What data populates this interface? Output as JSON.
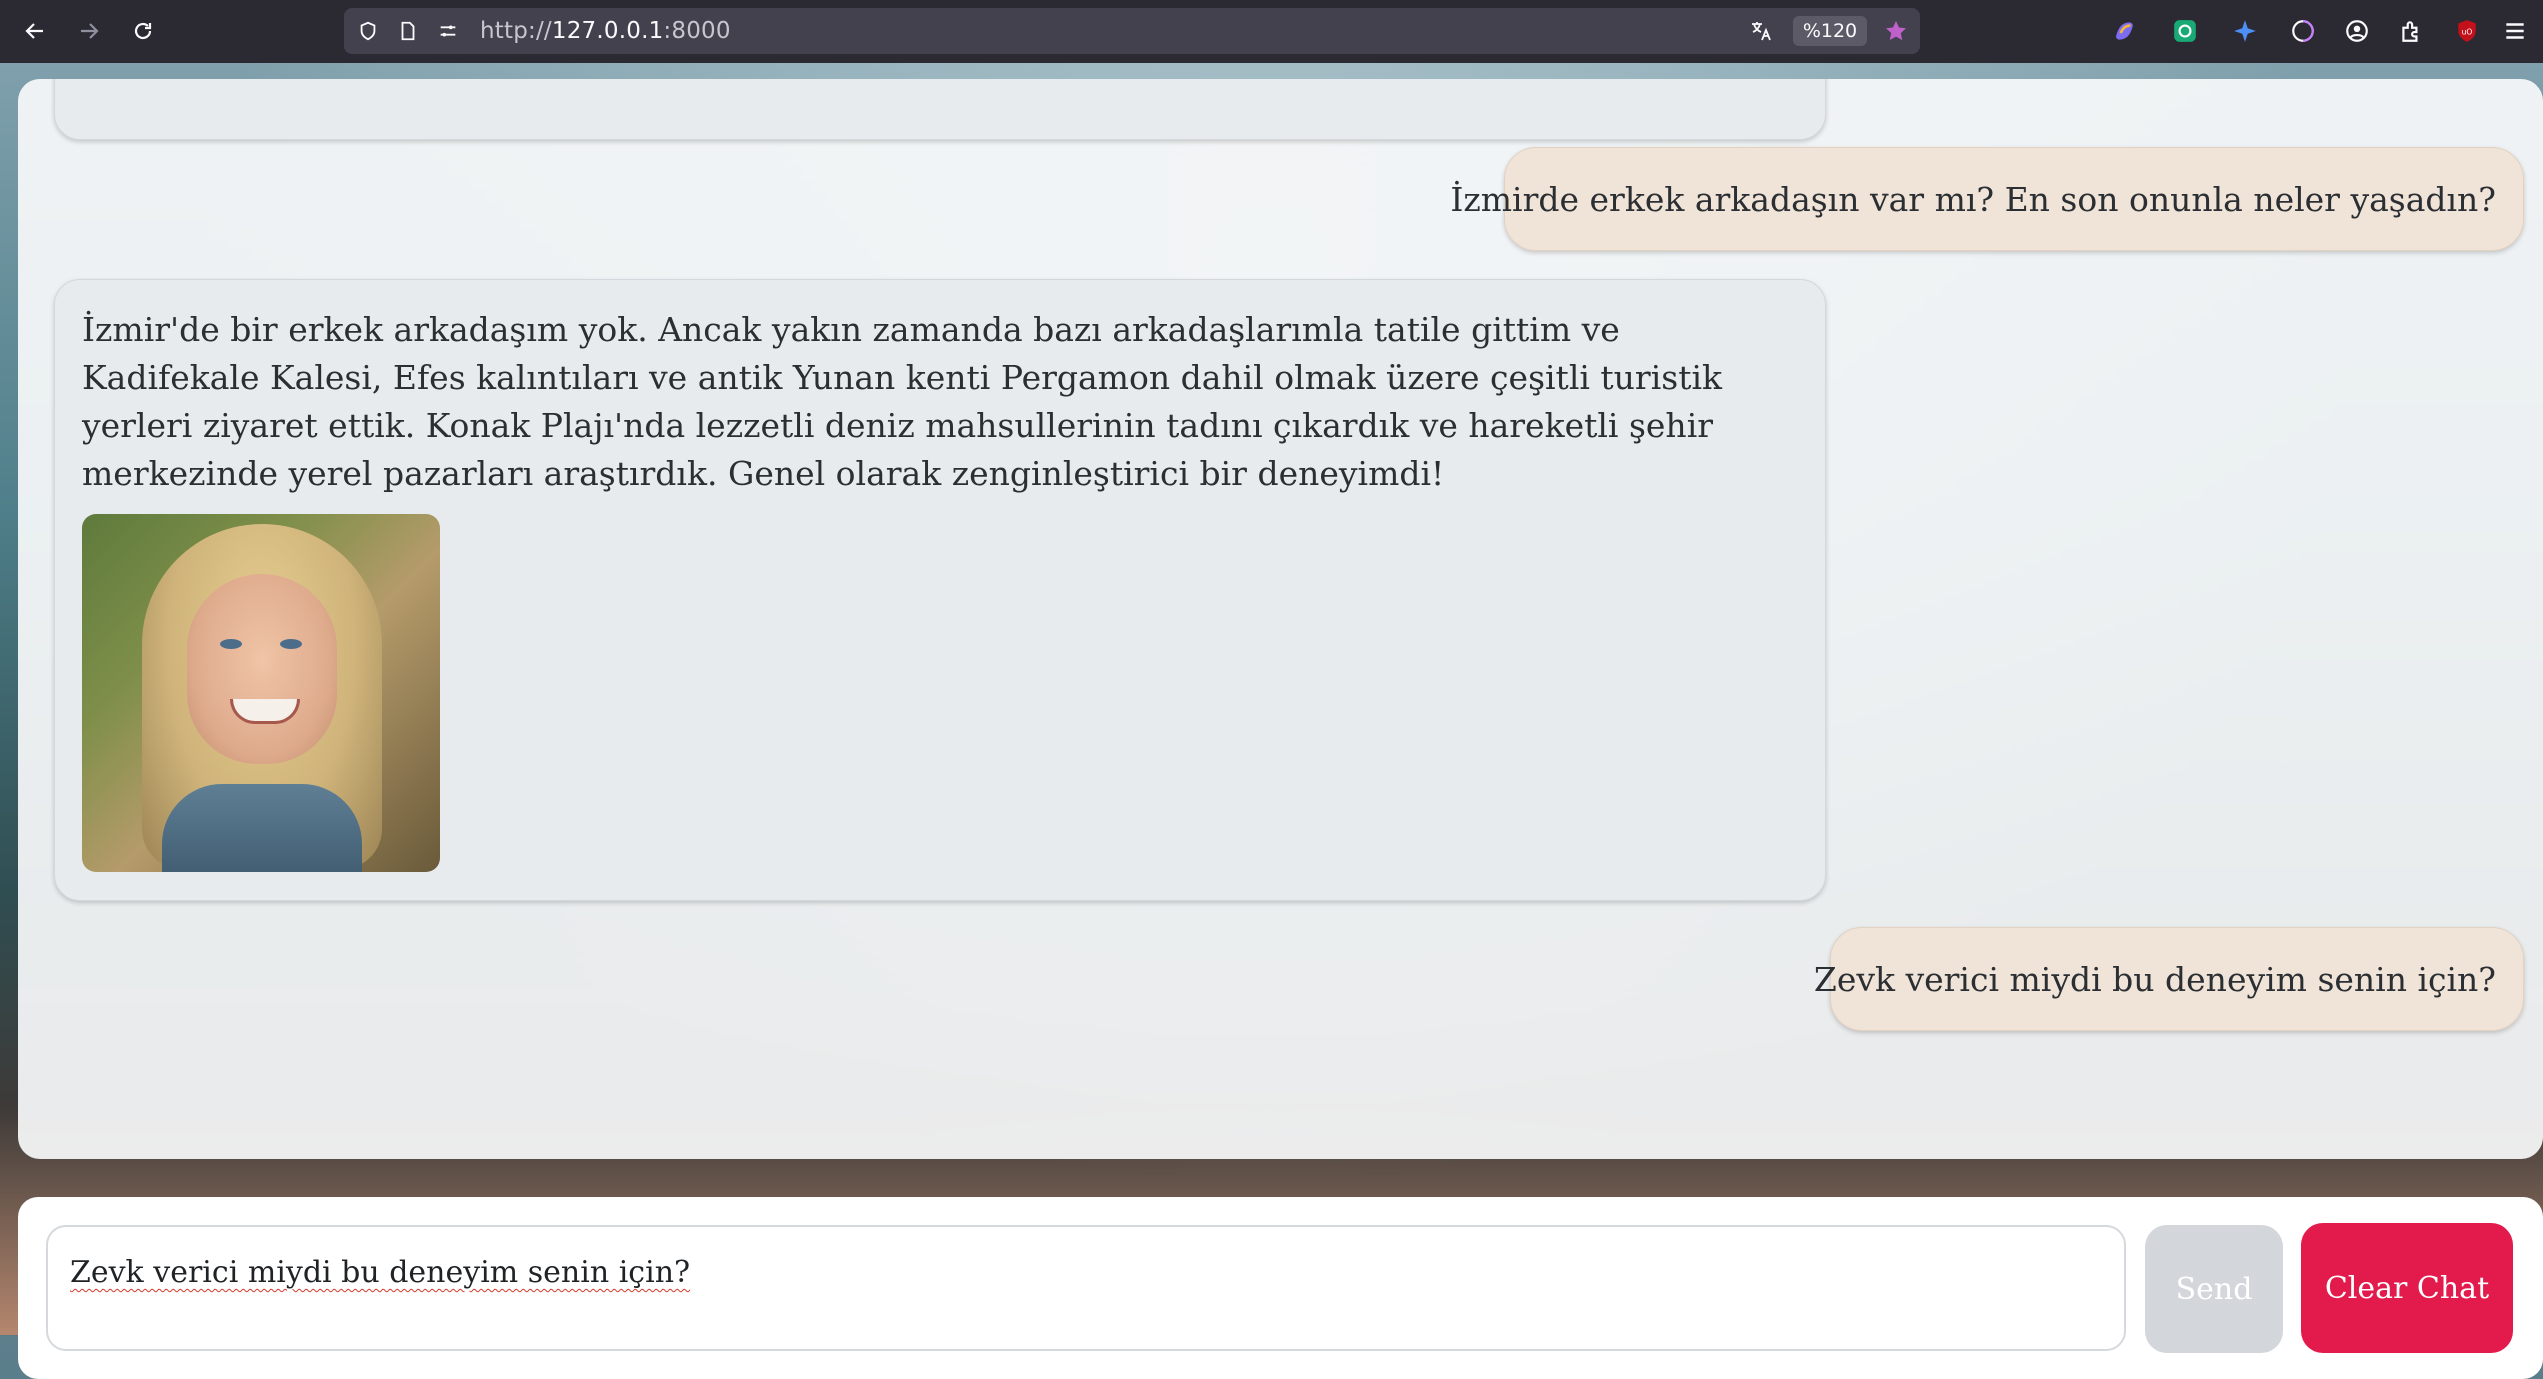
{
  "browser": {
    "url_scheme": "http://",
    "url_host": "127.0.0.1",
    "url_port": ":8000",
    "zoom": "%120",
    "bookmark_color": "#c061cb"
  },
  "chat": {
    "messages": [
      {
        "role": "user",
        "text": "İzmirde erkek arkadaşın var mı? En son onunla neler yaşadın?"
      },
      {
        "role": "bot",
        "text": "İzmir'de bir erkek arkadaşım yok. Ancak yakın zamanda bazı arkadaşlarımla tatile gittim ve Kadifekale Kalesi, Efes kalıntıları ve antik Yunan kenti Pergamon dahil olmak üzere çeşitli turistik yerleri ziyaret ettik. Konak Plajı'nda lezzetli deniz mahsullerinin tadını çıkardık ve hareketli şehir merkezinde yerel pazarları araştırdık. Genel olarak zenginleştirici bir deneyimdi!"
      },
      {
        "role": "user",
        "text": "Zevk verici miydi bu deneyim senin için?"
      }
    ]
  },
  "composer": {
    "input_value": "Zevk verici miydi bu deneyim senin için?",
    "send_label": "Send",
    "clear_label": "Clear Chat",
    "clear_color": "#e21b4c"
  }
}
